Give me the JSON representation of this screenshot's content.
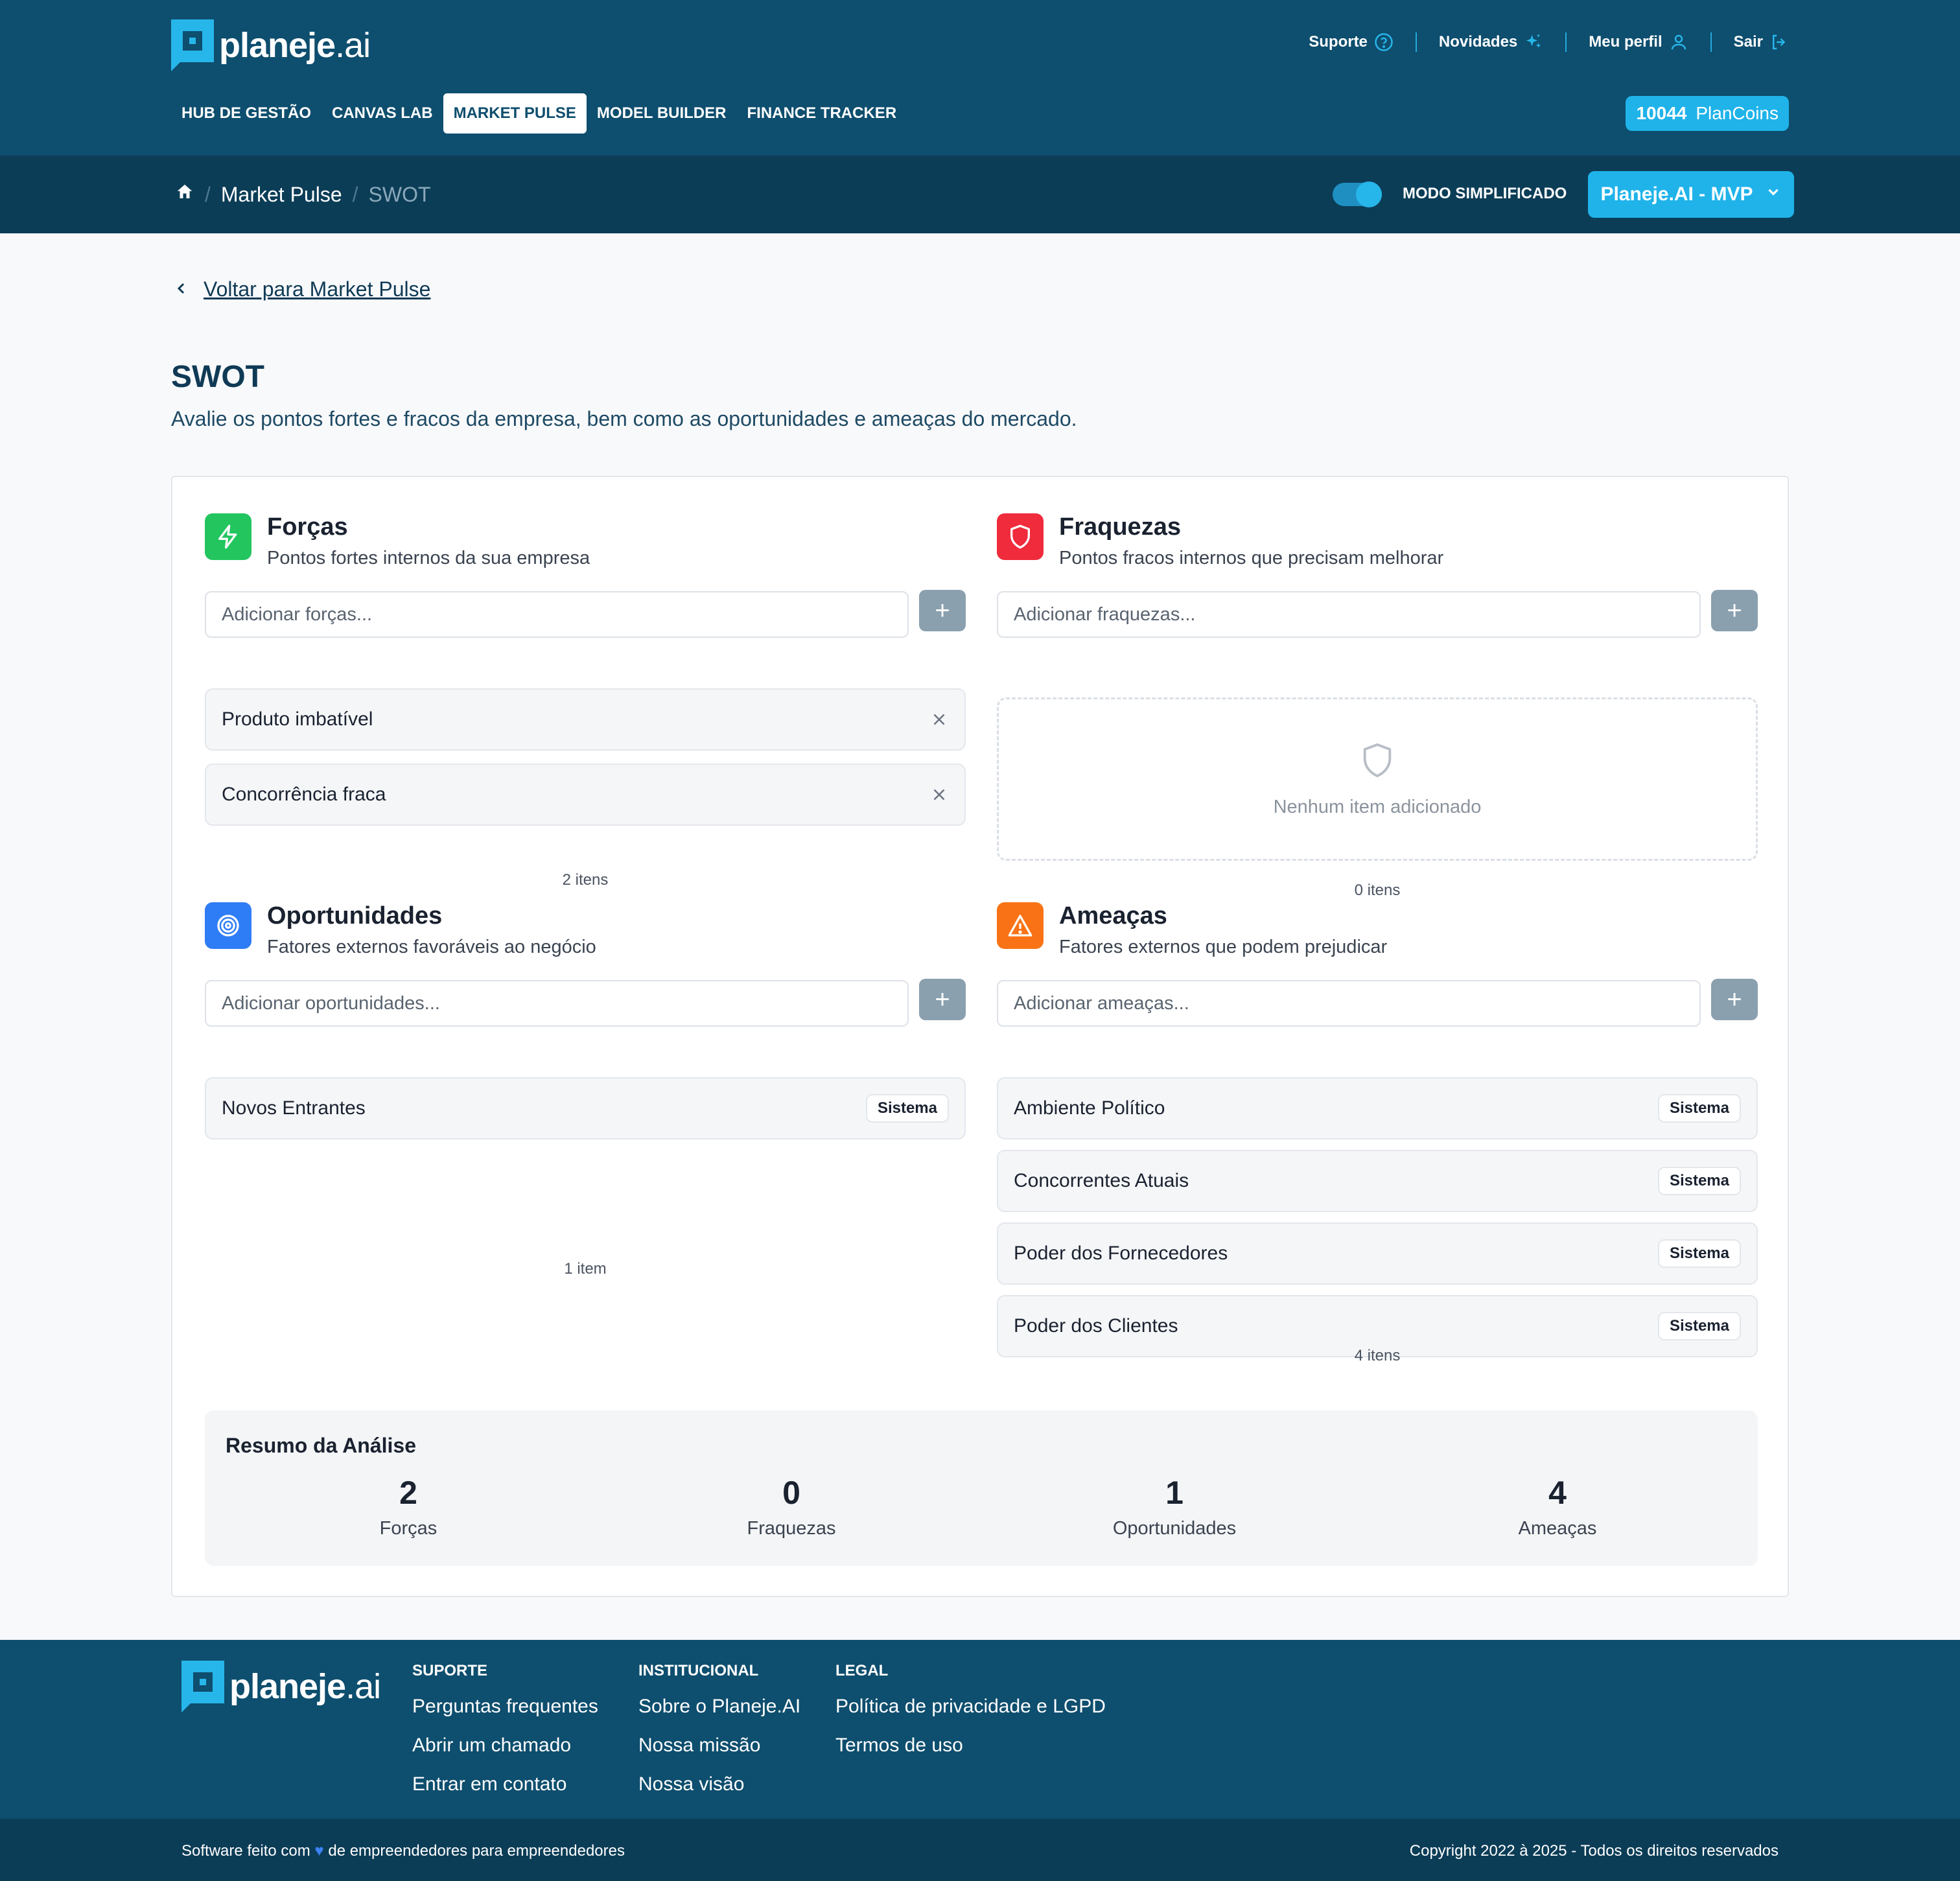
{
  "brand": {
    "word_bold": "planeje",
    "word_light": ".ai"
  },
  "toplinks": {
    "support": "Suporte",
    "news": "Novidades",
    "profile": "Meu perfil",
    "logout": "Sair"
  },
  "nav": {
    "tabs": [
      {
        "label": "HUB DE GESTÃO",
        "active": false
      },
      {
        "label": "CANVAS LAB",
        "active": false
      },
      {
        "label": "MARKET PULSE",
        "active": true
      },
      {
        "label": "MODEL BUILDER",
        "active": false
      },
      {
        "label": "FINANCE TRACKER",
        "active": false
      }
    ],
    "coins_value": "10044",
    "coins_label": "PlanCoins"
  },
  "breadcrumb": {
    "section": "Market Pulse",
    "current": "SWOT"
  },
  "mode": {
    "label": "MODO SIMPLIFICADO",
    "enabled": true
  },
  "project_selector": "Planeje.AI - MVP",
  "back_link": "Voltar para Market Pulse",
  "page": {
    "title": "SWOT",
    "subtitle": "Avalie os pontos fortes e fracos da empresa, bem como as oportunidades e ameaças do mercado."
  },
  "quadrants": {
    "strengths": {
      "title": "Forças",
      "desc": "Pontos fortes internos da sua empresa",
      "placeholder": "Adicionar forças...",
      "items": [
        "Produto imbatível",
        "Concorrência fraca"
      ],
      "count": "2 itens",
      "color": "#22c55e"
    },
    "weaknesses": {
      "title": "Fraquezas",
      "desc": "Pontos fracos internos que precisam melhorar",
      "placeholder": "Adicionar fraquezas...",
      "empty_text": "Nenhum item adicionado",
      "count": "0 itens",
      "color": "#ef2b3c"
    },
    "opportunities": {
      "title": "Oportunidades",
      "desc": "Fatores externos favoráveis ao negócio",
      "placeholder": "Adicionar oportunidades...",
      "items": [
        "Novos Entrantes"
      ],
      "badge": "Sistema",
      "count": "1 item",
      "color": "#2f7df6"
    },
    "threats": {
      "title": "Ameaças",
      "desc": "Fatores externos que podem prejudicar",
      "placeholder": "Adicionar ameaças...",
      "items": [
        "Ambiente Político",
        "Concorrentes Atuais",
        "Poder dos Fornecedores",
        "Poder dos Clientes"
      ],
      "badge": "Sistema",
      "count": "4 itens",
      "color": "#f97316"
    }
  },
  "summary": {
    "title": "Resumo da Análise",
    "stats": [
      {
        "value": "2",
        "label": "Forças"
      },
      {
        "value": "0",
        "label": "Fraquezas"
      },
      {
        "value": "1",
        "label": "Oportunidades"
      },
      {
        "value": "4",
        "label": "Ameaças"
      }
    ]
  },
  "footer": {
    "columns": [
      {
        "head": "SUPORTE",
        "links": [
          "Perguntas frequentes",
          "Abrir um chamado",
          "Entrar em contato"
        ]
      },
      {
        "head": "INSTITUCIONAL",
        "links": [
          "Sobre o Planeje.AI",
          "Nossa missão",
          "Nossa visão"
        ]
      },
      {
        "head": "LEGAL",
        "links": [
          "Política de privacidade e LGPD",
          "Termos de uso"
        ]
      }
    ],
    "tagline_before": "Software feito com",
    "tagline_after": "de empreendedores para empreendedores",
    "copyright": "Copyright 2022 à 2025 - Todos os direitos reservados"
  }
}
